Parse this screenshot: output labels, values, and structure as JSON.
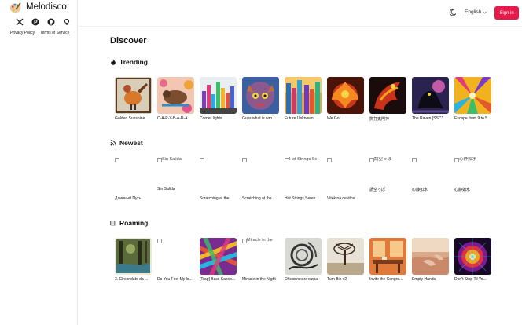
{
  "app": {
    "name": "Melodisco"
  },
  "legal": {
    "privacy": "Privacy Policy",
    "terms": "Terms of Service"
  },
  "header": {
    "language": "English",
    "signin": "Sign in"
  },
  "page": {
    "title": "Discover"
  },
  "sections": {
    "trending": {
      "title": "Trending",
      "items": [
        "Golden Sunshine...",
        "C-A-P-Y-B-A-R-A",
        "Corner lights",
        "Guys what is wro...",
        "Future Unknown",
        "We Go!",
        "撕打鬼門神",
        "The Raven [SSC3...",
        "Escape from 9 to 5"
      ]
    },
    "newest": {
      "title": "Newest",
      "items": [
        {
          "title": "Длинный Путь",
          "alt": ""
        },
        {
          "title": "Sin Salida",
          "alt": "Sin Salida"
        },
        {
          "title": "Scratching at the...",
          "alt": ""
        },
        {
          "title": "Scratching at the ...",
          "alt": ""
        },
        {
          "title": "Hot Strings Seren...",
          "alt": "Hot Strings Se"
        },
        {
          "title": "Vitek na devitce",
          "alt": ""
        },
        {
          "title": "請空っぽ",
          "alt": "請空っぽ"
        },
        {
          "title": "心静如水",
          "alt": ""
        },
        {
          "title": "心静如水",
          "alt": "心静如水"
        }
      ]
    },
    "roaming": {
      "title": "Roaming",
      "items": [
        {
          "title": "3. Circondato da ...",
          "alt": ""
        },
        {
          "title": "Do You Feel My lo...",
          "alt": ""
        },
        {
          "title": "[Trap] Bass Saxop...",
          "alt": ""
        },
        {
          "title": "Miracle in the Night",
          "alt": "Miracle in the"
        },
        {
          "title": "Обновление мира",
          "alt": ""
        },
        {
          "title": "Tum Bin v2",
          "alt": ""
        },
        {
          "title": "Invite the Congre...",
          "alt": ""
        },
        {
          "title": "Empty Hands",
          "alt": ""
        },
        {
          "title": "Don't Stop Til Yo...",
          "alt": ""
        }
      ]
    }
  },
  "colors": {
    "accent": "#e5194a"
  }
}
